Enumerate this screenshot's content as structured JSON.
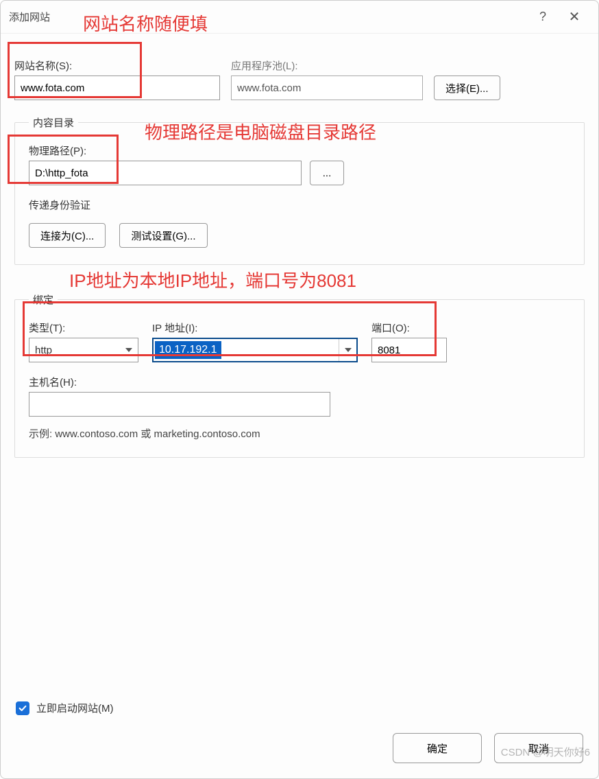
{
  "window": {
    "title": "添加网站"
  },
  "annotations": {
    "site_name": "网站名称随便填",
    "phys_path": "物理路径是电脑磁盘目录路径",
    "binding": "IP地址为本地IP地址，端口号为8081"
  },
  "fields": {
    "site_name_label": "网站名称(S):",
    "site_name_value": "www.fota.com",
    "app_pool_label": "应用程序池(L):",
    "app_pool_value": "www.fota.com",
    "select_btn": "选择(E)..."
  },
  "content_dir": {
    "legend": "内容目录",
    "phys_path_label": "物理路径(P):",
    "phys_path_value": "D:\\http_fota",
    "browse_btn": "...",
    "passthrough_label": "传递身份验证",
    "connect_as_btn": "连接为(C)...",
    "test_btn": "测试设置(G)..."
  },
  "binding": {
    "legend": "绑定",
    "type_label": "类型(T):",
    "type_value": "http",
    "ip_label": "IP 地址(I):",
    "ip_value": "10.17.192.1",
    "port_label": "端口(O):",
    "port_value": "8081",
    "host_label": "主机名(H):",
    "host_value": "",
    "example_text": "示例: www.contoso.com 或 marketing.contoso.com"
  },
  "start_checkbox": {
    "checked": true,
    "label": "立即启动网站(M)"
  },
  "footer": {
    "ok": "确定",
    "cancel": "取消"
  },
  "watermark": "CSDN @明天你好6"
}
